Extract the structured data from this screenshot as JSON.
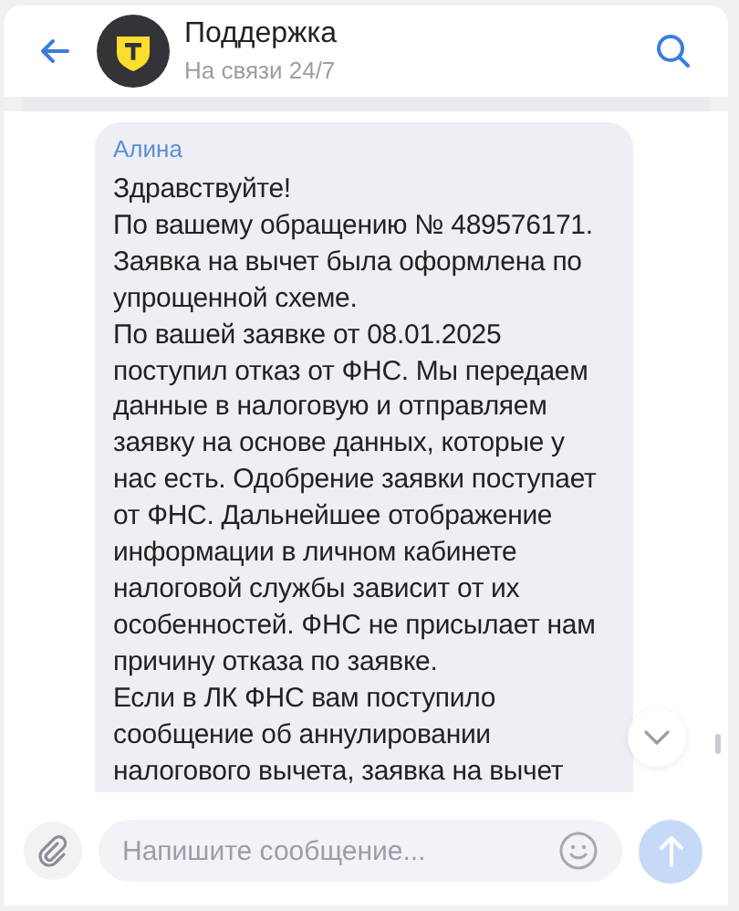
{
  "header": {
    "title": "Поддержка",
    "subtitle": "На связи 24/7"
  },
  "messages": [
    {
      "author": "Алина",
      "text": "Здравствуйте!\nПо вашему обращению № 489576171.\nЗаявка на вычет была оформлена по\nупрощенной схеме.\nПо вашей заявке от 08.01.2025\nпоступил отказ от ФНС. Мы передаем\nданные в налоговую и отправляем\nзаявку на основе данных, которые у\nнас есть. Одобрение заявки поступает\nот ФНС. Дальнейшее отображение\nинформации в личном кабинете\nналоговой службы зависит от их\nособенностей. ФНС не присылает нам\nпричину отказа по заявке.\nЕсли в ЛК ФНС вам поступило\nсообщение об аннулировании\nналогового вычета, заявка на вычет"
    }
  ],
  "composer": {
    "placeholder": "Напишите сообщение..."
  }
}
